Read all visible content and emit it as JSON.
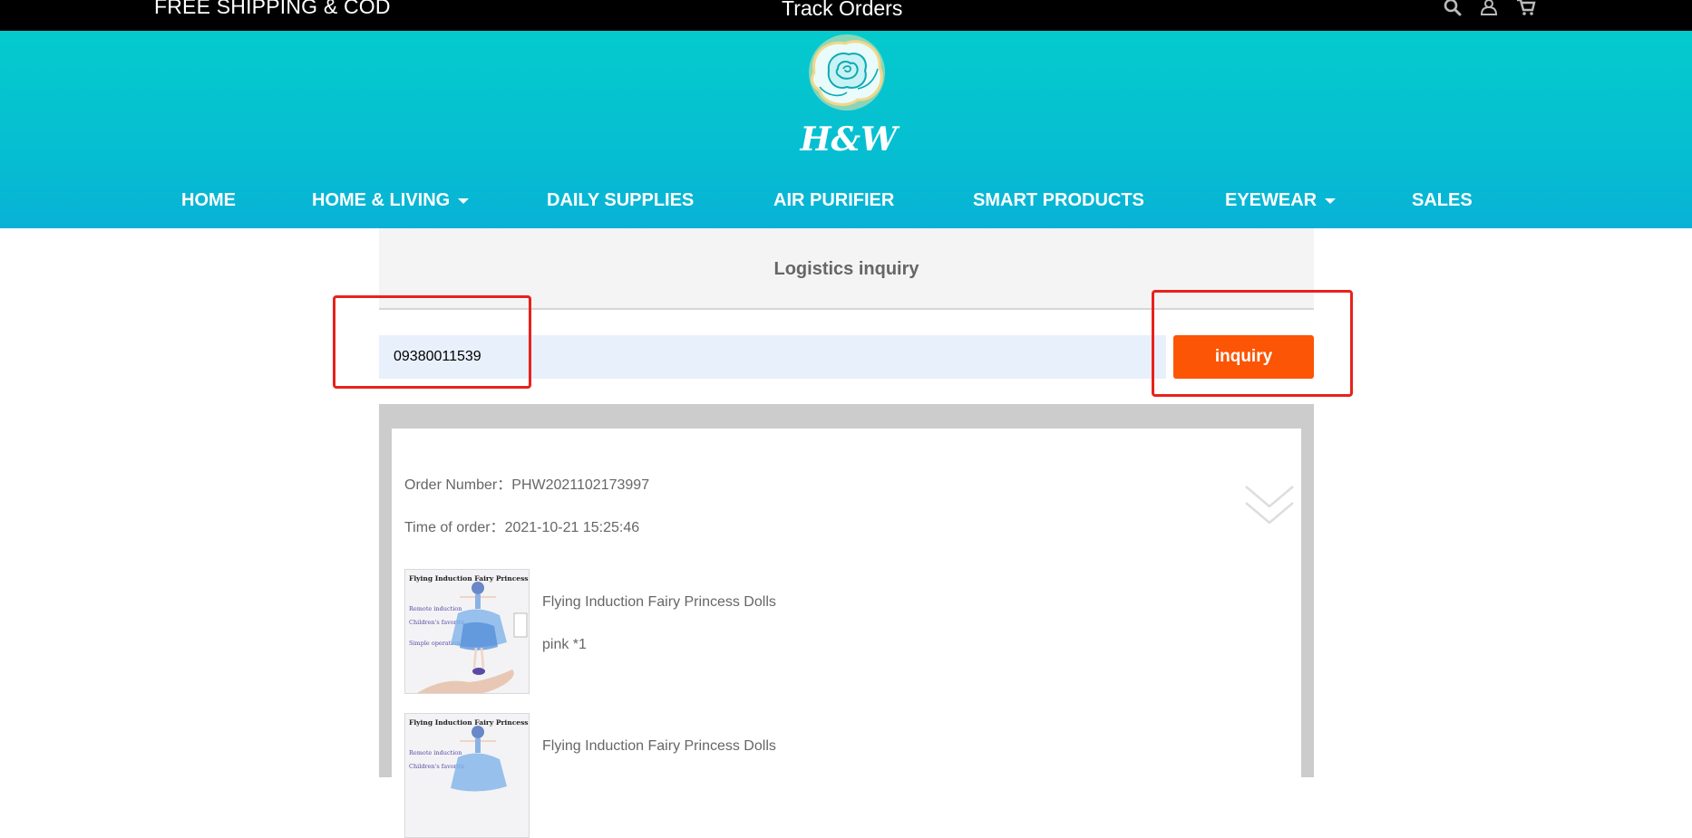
{
  "topbar": {
    "promo": "FREE SHIPPING & COD",
    "track_orders": "Track Orders",
    "icons": [
      "search-icon",
      "user-icon",
      "cart-icon"
    ]
  },
  "brand": {
    "logo_text": "H&W"
  },
  "nav": {
    "items": [
      {
        "label": "HOME",
        "has_dropdown": false
      },
      {
        "label": "HOME & LIVING",
        "has_dropdown": true
      },
      {
        "label": "DAILY SUPPLIES",
        "has_dropdown": false
      },
      {
        "label": "AIR PURIFIER",
        "has_dropdown": false
      },
      {
        "label": "SMART PRODUCTS",
        "has_dropdown": false
      },
      {
        "label": "EYEWEAR",
        "has_dropdown": true
      },
      {
        "label": "SALES",
        "has_dropdown": false
      }
    ]
  },
  "inquiry": {
    "title": "Logistics inquiry",
    "input_value": "09380011539",
    "button_label": "inquiry"
  },
  "order": {
    "number_label": "Order Number：",
    "number": "PHW2021102173997",
    "time_label": "Time of order：",
    "time": "2021-10-21 15:25:46",
    "items": [
      {
        "name": "Flying Induction Fairy Princess Dolls",
        "variant": "pink *1"
      },
      {
        "name": "Flying Induction Fairy Princess Dolls",
        "variant": ""
      }
    ],
    "thumb_text": {
      "title": "Flying Induction Fairy Princess Dolls",
      "line1": "Remote induction",
      "line2": "Children's favorite",
      "line3": "Simple operation"
    }
  },
  "colors": {
    "header_teal": "#06c0d1",
    "topbar": "#000000",
    "button_orange": "#fb5505",
    "highlight_red": "#e8221c",
    "input_bg": "#e8f0fb"
  }
}
